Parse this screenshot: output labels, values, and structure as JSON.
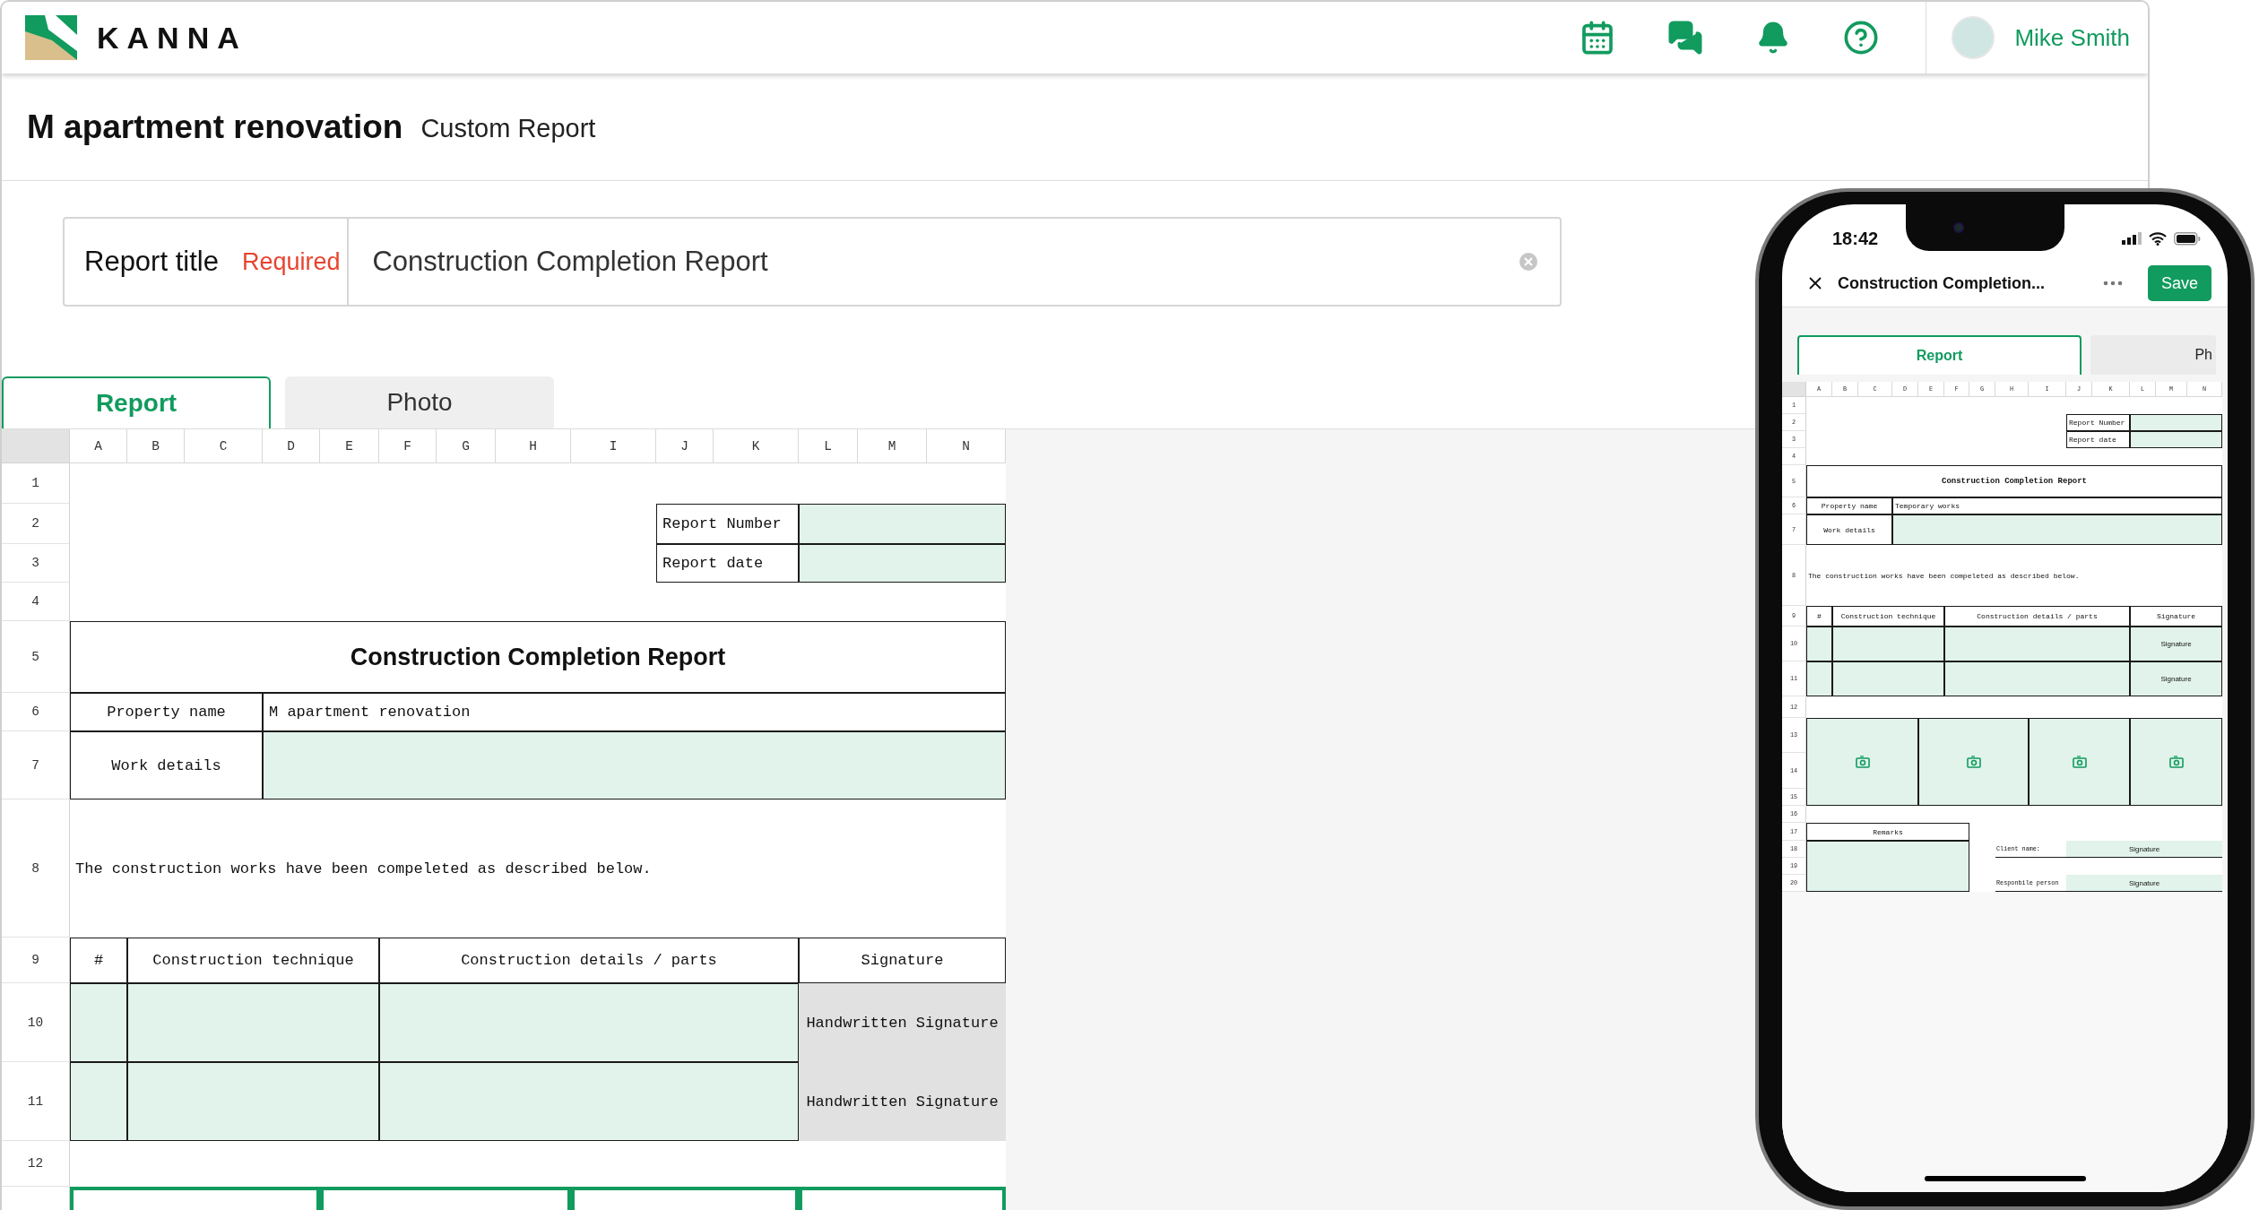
{
  "header": {
    "logo": "KANNA",
    "user": "Mike Smith"
  },
  "page": {
    "title": "M apartment renovation",
    "subtitle": "Custom Report"
  },
  "report_title": {
    "label": "Report title",
    "required": "Required",
    "value": "Construction Completion Report"
  },
  "tabs": [
    {
      "label": "Report",
      "selected": true
    },
    {
      "label": "Photo",
      "selected": false
    }
  ],
  "sheet": {
    "columns": [
      "A",
      "B",
      "C",
      "D",
      "E",
      "F",
      "G",
      "H",
      "I",
      "J",
      "K",
      "L",
      "M",
      "N"
    ],
    "rows": [
      "1",
      "2",
      "3",
      "4",
      "5",
      "6",
      "7",
      "8",
      "9",
      "10",
      "11",
      "12"
    ],
    "cells": [
      {
        "kind": "label",
        "text": "Report Number"
      },
      {
        "kind": "input"
      },
      {
        "kind": "label",
        "text": "Report date"
      },
      {
        "kind": "input"
      },
      {
        "kind": "title",
        "text": "Construction Completion Report"
      },
      {
        "kind": "field_label",
        "text": "Property name"
      },
      {
        "kind": "value",
        "text": "M apartment renovation"
      },
      {
        "kind": "field_label",
        "text": "Work details"
      },
      {
        "kind": "input"
      },
      {
        "kind": "text",
        "text": "The construction works have been compeleted as described below."
      },
      {
        "kind": "header",
        "text": "#"
      },
      {
        "kind": "header",
        "text": "Construction technique"
      },
      {
        "kind": "header",
        "text": "Construction details / parts"
      },
      {
        "kind": "header",
        "text": "Signature"
      },
      {
        "kind": "input"
      },
      {
        "kind": "input"
      },
      {
        "kind": "input"
      },
      {
        "kind": "signature",
        "text": "Handwritten Signature"
      },
      {
        "kind": "input"
      },
      {
        "kind": "input"
      },
      {
        "kind": "input"
      },
      {
        "kind": "signature",
        "text": "Handwritten Signature"
      },
      {
        "kind": "photo"
      },
      {
        "kind": "photo"
      },
      {
        "kind": "photo"
      },
      {
        "kind": "photo"
      }
    ]
  },
  "phone": {
    "time": "18:42",
    "title": "Construction Completion...",
    "save": "Save",
    "tabs": [
      {
        "label": "Report",
        "selected": true
      },
      {
        "label": "Ph",
        "selected": false
      }
    ],
    "sheet": {
      "columns": [
        "A",
        "B",
        "C",
        "D",
        "E",
        "F",
        "G",
        "H",
        "I",
        "J",
        "K",
        "L",
        "M",
        "N"
      ],
      "rows": [
        "1",
        "2",
        "3",
        "4",
        "5",
        "6",
        "7",
        "8",
        "9",
        "10",
        "11",
        "12",
        "13",
        "14",
        "15",
        "16",
        "17",
        "18",
        "19",
        "20"
      ],
      "cells": [
        {
          "kind": "label",
          "text": "Report Number"
        },
        {
          "kind": "input"
        },
        {
          "kind": "label",
          "text": "Report date"
        },
        {
          "kind": "input"
        },
        {
          "kind": "title",
          "text": "Construction Completion Report"
        },
        {
          "kind": "field_label",
          "text": "Property name"
        },
        {
          "kind": "value",
          "text": "Temporary works"
        },
        {
          "kind": "field_label",
          "text": "Work details"
        },
        {
          "kind": "input"
        },
        {
          "kind": "text",
          "text": "The construction works have been compeleted as described below."
        },
        {
          "kind": "header",
          "text": "#"
        },
        {
          "kind": "header",
          "text": "Construction technique"
        },
        {
          "kind": "header",
          "text": "Construction details / parts"
        },
        {
          "kind": "header",
          "text": "Signature"
        },
        {
          "kind": "input"
        },
        {
          "kind": "input"
        },
        {
          "kind": "input"
        },
        {
          "kind": "signature",
          "text": "Signature"
        },
        {
          "kind": "input"
        },
        {
          "kind": "input"
        },
        {
          "kind": "input"
        },
        {
          "kind": "signature",
          "text": "Signature"
        },
        {
          "kind": "photo"
        },
        {
          "kind": "photo"
        },
        {
          "kind": "photo"
        },
        {
          "kind": "photo"
        },
        {
          "kind": "header",
          "text": "Remarks"
        },
        {
          "kind": "input"
        },
        {
          "kind": "caption",
          "text": "Client name:"
        },
        {
          "kind": "signature_line",
          "text": "Signature"
        },
        {
          "kind": "caption",
          "text": "Responbile person"
        },
        {
          "kind": "signature_line",
          "text": "Signature"
        }
      ]
    }
  }
}
